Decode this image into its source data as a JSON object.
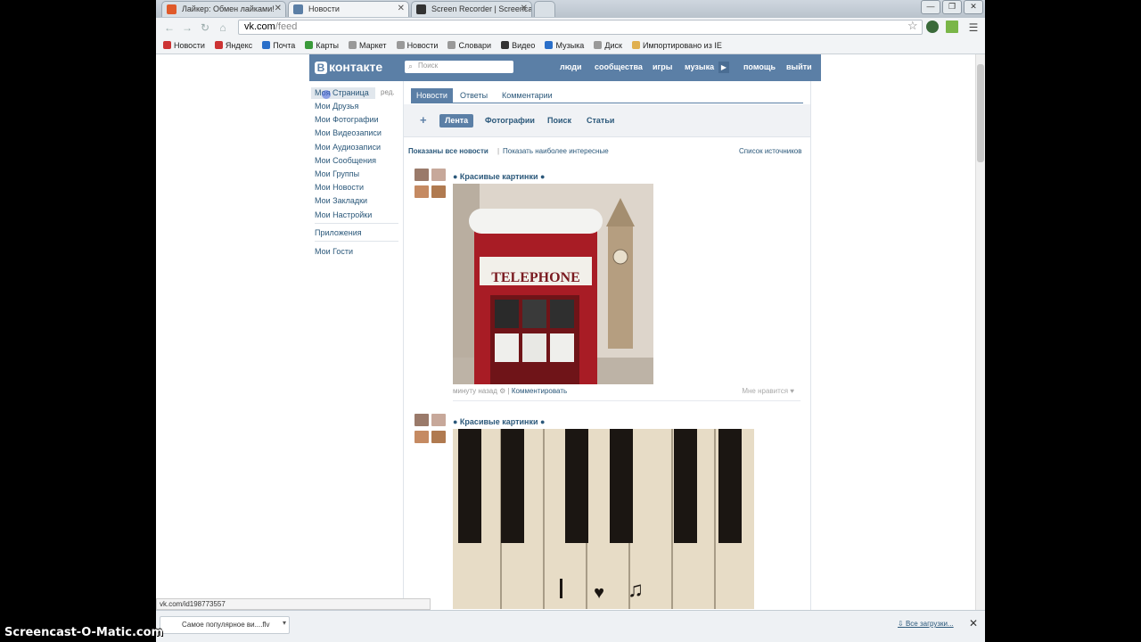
{
  "browser": {
    "tabs": [
      {
        "title": "Лайкер: Обмен лайками!",
        "color": "#e05a2a"
      },
      {
        "title": "Новости",
        "color": "#5b7fa6"
      },
      {
        "title": "Screen Recorder | Screenca",
        "color": "#333333"
      }
    ],
    "address": {
      "host": "vk.com",
      "path": "/feed"
    },
    "bookmarks": [
      "Новости",
      "Яндекс",
      "Почта",
      "Карты",
      "Маркет",
      "Новости",
      "Словари",
      "Видео",
      "Музыка",
      "Диск",
      "Импортировано из IE"
    ]
  },
  "vk": {
    "logo": "контакте",
    "logo_letter": "В",
    "search_placeholder": "Поиск",
    "nav": [
      "люди",
      "сообщества",
      "игры",
      "музыка",
      "помощь",
      "выйти"
    ],
    "menu": {
      "my_page": "Моя Страница",
      "edit": "ред.",
      "items": [
        "Мои Друзья",
        "Мои Фотографии",
        "Мои Видеозаписи",
        "Мои Аудиозаписи",
        "Мои Сообщения",
        "Мои Группы",
        "Мои Новости",
        "Мои Закладки",
        "Мои Настройки"
      ],
      "apps": "Приложения",
      "guests": "Мои Гости"
    },
    "tabs": [
      "Новости",
      "Ответы",
      "Комментарии"
    ],
    "subtabs": [
      "Лента",
      "Фотографии",
      "Поиск",
      "Статьи"
    ],
    "filter": {
      "all": "Показаны все новости",
      "sep": "|",
      "interesting": "Показать наиболее интересные",
      "sources": "Список источников"
    },
    "posts": [
      {
        "group": "● Красивые картинки ●",
        "time": "минуту назад",
        "comment": "Комментировать",
        "like": "Мне нравится ♥",
        "photo_text": "TELEPHONE"
      },
      {
        "group": "● Красивые картинки ●"
      }
    ]
  },
  "status_url": "vk.com/id198773557",
  "download": {
    "item": "Самое популярное ви....flv",
    "all": "Все загрузки..."
  },
  "watermark": "Screencast-O-Matic.com"
}
